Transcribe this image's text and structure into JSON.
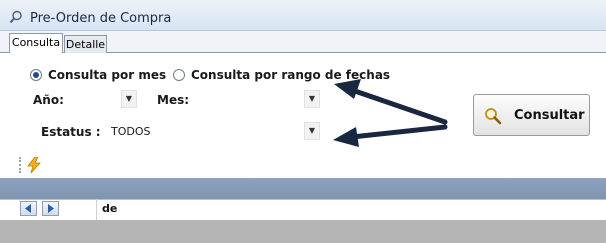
{
  "window": {
    "title": "Pre-Orden de Compra"
  },
  "tabs": [
    {
      "label": "Consulta",
      "active": true
    },
    {
      "label": "Detalle",
      "active": false
    }
  ],
  "options": {
    "por_mes": {
      "label": "Consulta por mes",
      "checked": true
    },
    "por_rango": {
      "label": "Consulta por rango de fechas",
      "checked": false
    }
  },
  "filters": {
    "anio": {
      "label": "Año:",
      "value": ""
    },
    "mes": {
      "label": "Mes:",
      "value": ""
    },
    "estatus": {
      "label": "Estatus :",
      "value": "TODOS"
    }
  },
  "actions": {
    "consultar_label": "Consultar"
  },
  "grid": {
    "nav_text": "de"
  },
  "icons": [
    "search-icon",
    "lightning-icon",
    "nav-prev-icon",
    "nav-next-icon",
    "chevron-down-icon"
  ]
}
